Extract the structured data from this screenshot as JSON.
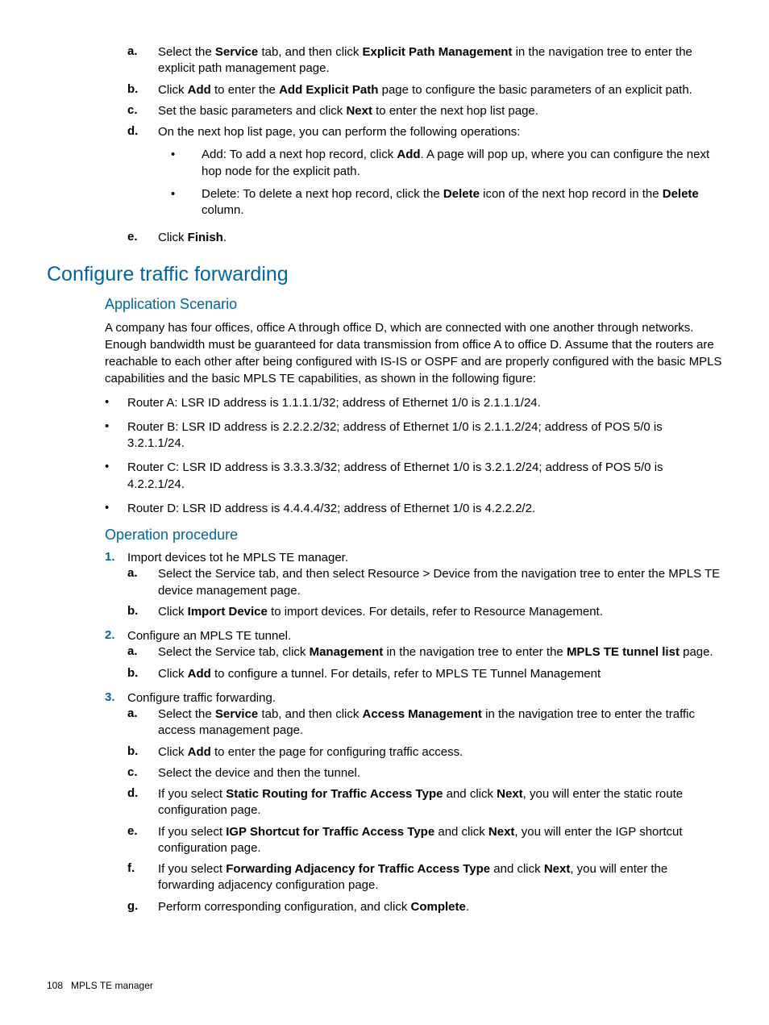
{
  "top_list": {
    "a": {
      "pre": "Select the ",
      "b1": "Service",
      "mid1": " tab, and then click ",
      "b2": "Explicit Path Management",
      "post": " in the navigation tree to enter the explicit path management page."
    },
    "b": {
      "pre": "Click ",
      "b1": "Add",
      "mid1": " to enter the ",
      "b2": "Add Explicit Path",
      "post": " page to configure the basic parameters of an explicit path."
    },
    "c": {
      "pre": "Set the basic parameters and click ",
      "b1": "Next",
      "post": " to enter the next hop list page."
    },
    "d": {
      "text": "On the next hop list page, you can perform the following operations:",
      "sub": {
        "add": {
          "pre": "Add: To add a next hop record, click ",
          "b1": "Add",
          "post": ". A page will pop up, where you can configure the next hop node for the explicit path."
        },
        "del": {
          "pre": "Delete: To delete a next hop record, click the ",
          "b1": "Delete",
          "mid1": " icon of the next hop record in the ",
          "b2": "Delete",
          "post": " column."
        }
      }
    },
    "e": {
      "pre": "Click ",
      "b1": "Finish",
      "post": "."
    }
  },
  "section_title": "Configure traffic forwarding",
  "app_scenario_title": "Application Scenario",
  "app_scenario_para": "A company has four offices, office A through office D, which are connected with one another through networks. Enough bandwidth must be guaranteed for data transmission from office A to office D. Assume that the routers are reachable to each other after being configured with IS-IS or OSPF and are properly configured with the basic MPLS capabilities and the basic MPLS TE capabilities, as shown in the following figure:",
  "routers": {
    "a": "Router A: LSR ID address is 1.1.1.1/32; address of Ethernet 1/0 is 2.1.1.1/24.",
    "b": "Router B: LSR ID address is 2.2.2.2/32; address of Ethernet 1/0 is 2.1.1.2/24; address of POS 5/0 is 3.2.1.1/24.",
    "c": "Router C: LSR ID address is 3.3.3.3/32; address of Ethernet 1/0 is 3.2.1.2/24; address of POS 5/0 is 4.2.2.1/24.",
    "d": "Router D: LSR ID address is 4.4.4.4/32; address of Ethernet 1/0 is 4.2.2.2/2."
  },
  "operation_title": "Operation procedure",
  "step1": {
    "text": "Import devices tot he MPLS TE manager.",
    "a": "Select the Service tab, and then select Resource > Device from the navigation tree to enter the MPLS TE device management page.",
    "b": {
      "pre": "Click ",
      "b1": "Import Device",
      "post": " to import devices. For details, refer to Resource Management."
    }
  },
  "step2": {
    "text": "Configure an MPLS TE tunnel.",
    "a": {
      "pre": "Select the Service tab, click ",
      "b1": "Management",
      "mid1": " in the navigation tree to enter the ",
      "b2": "MPLS TE tunnel list",
      "post": " page."
    },
    "b": {
      "pre": "Click ",
      "b1": "Add",
      "post": " to configure a tunnel. For details, refer to MPLS TE Tunnel Management"
    }
  },
  "step3": {
    "text": "Configure traffic forwarding.",
    "a": {
      "pre": "Select the ",
      "b1": "Service",
      "mid1": " tab, and then click ",
      "b2": "Access Management",
      "post": " in the navigation tree to enter the traffic access management page."
    },
    "b": {
      "pre": "Click ",
      "b1": "Add",
      "post": " to enter the page for configuring traffic access."
    },
    "c": "Select the device and then the tunnel.",
    "d": {
      "pre": "If you select ",
      "b1": "Static Routing for Traffic Access Type",
      "mid1": " and click ",
      "b2": "Next",
      "post": ", you will enter the static route configuration page."
    },
    "e": {
      "pre": "If you select ",
      "b1": "IGP Shortcut for Traffic Access Type",
      "mid1": " and click ",
      "b2": "Next",
      "post": ", you will enter the IGP shortcut configuration page."
    },
    "f": {
      "pre": "If you select ",
      "b1": "Forwarding Adjacency for Traffic Access Type",
      "mid1": " and click ",
      "b2": "Next",
      "post": ", you will enter the forwarding adjacency configuration page."
    },
    "g": {
      "pre": "Perform corresponding configuration, and click ",
      "b1": "Complete",
      "post": "."
    }
  },
  "footer": {
    "page": "108",
    "title": "MPLS TE manager"
  }
}
